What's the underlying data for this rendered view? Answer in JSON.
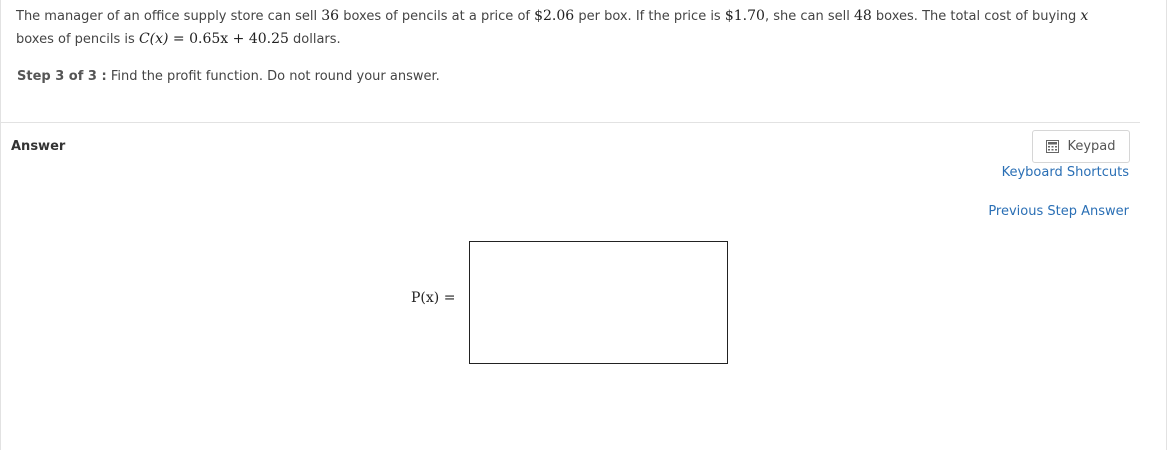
{
  "problem": {
    "p1": "The manager of an office supply store can sell ",
    "n1": "36",
    "p2": " boxes of pencils at a price of ",
    "n2": "$2.06",
    "p3": " per box.  If the price is ",
    "n3": "$1.70",
    "p4": ", she can sell ",
    "n4": "48",
    "p5": " boxes.  The total cost of buying ",
    "var_x": "x",
    "p6": "boxes of pencils is ",
    "cost_fn": "C(x)",
    "eq": " = ",
    "cost_expr": "0.65x + 40.25",
    "p7": " dollars."
  },
  "step": {
    "label": "Step 3 of 3 :",
    "instruction": "Find the profit function. Do not round your answer."
  },
  "answer": {
    "label": "Answer",
    "fn_label": "P(x) =",
    "input_value": ""
  },
  "tools": {
    "keypad_label": "Keypad",
    "keypad_icon": "calculator-icon",
    "keyboard_shortcuts_label": "Keyboard Shortcuts",
    "previous_step_label": "Previous Step Answer"
  },
  "colors": {
    "link": "#2a6fb5",
    "text": "#444444",
    "border": "#e2e2e2"
  }
}
